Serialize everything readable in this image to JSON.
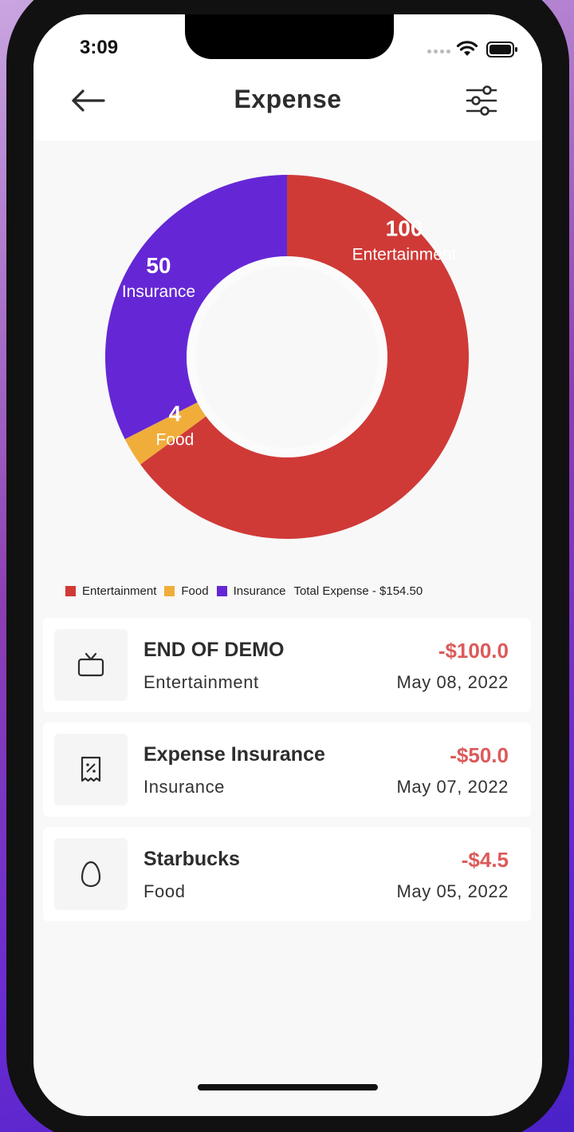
{
  "status_bar": {
    "time": "3:09"
  },
  "header": {
    "title": "Expense"
  },
  "chart_data": {
    "type": "pie",
    "categories": [
      "Entertainment",
      "Food",
      "Insurance"
    ],
    "values": [
      100,
      4,
      50
    ],
    "colors": [
      "#cf3a37",
      "#f0ad3a",
      "#6527d6"
    ],
    "donut": true,
    "center_ring_color": "#b9a8e8",
    "slice_labels": [
      {
        "value": "100",
        "name": "Entertainment"
      },
      {
        "value": "4",
        "name": "Food"
      },
      {
        "value": "50",
        "name": "Insurance"
      }
    ],
    "legend_position": "bottom-left"
  },
  "legend": {
    "items": [
      {
        "label": "Entertainment",
        "color": "#cf3a37"
      },
      {
        "label": "Food",
        "color": "#f0ad3a"
      },
      {
        "label": "Insurance",
        "color": "#6527d6"
      }
    ],
    "total": "Total Expense - $154.50"
  },
  "transactions": [
    {
      "title": "END OF DEMO",
      "category": "Entertainment",
      "amount": "-$100.0",
      "date": "May 08, 2022",
      "icon": "tv-icon"
    },
    {
      "title": "Expense Insurance",
      "category": "Insurance",
      "amount": "-$50.0",
      "date": "May 07, 2022",
      "icon": "receipt-icon"
    },
    {
      "title": "Starbucks",
      "category": "Food",
      "amount": "-$4.5",
      "date": "May 05, 2022",
      "icon": "egg-icon"
    }
  ]
}
